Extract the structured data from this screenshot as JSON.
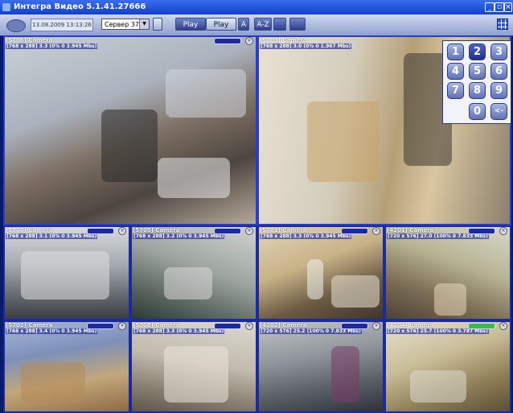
{
  "window": {
    "title": "Интегра Видео 5.1.41.27666"
  },
  "toolbar": {
    "datetime": "13.08.2009  13:13:26",
    "server": "Сервер 37",
    "buttons": [
      "Play",
      "Play",
      "A",
      "A-Z",
      "",
      ""
    ]
  },
  "cameras": [
    {
      "label": "[5706] Camera",
      "info": "[768 x 288] 3.3 (0% 0 3.945 Mbs)"
    },
    {
      "label": "[5703] Camera",
      "info": "[768 x 288] 3.0 (0% 0 1.967 Mbs)"
    },
    {
      "label": "[5707] Camera",
      "info": "[768 x 288] 3.1 (0% 0 3.945 Mbs)"
    },
    {
      "label": "[5705] Camera",
      "info": "[768 x 288] 3.2 (0% 0 3.945 Mbs)"
    },
    {
      "label": "[5701] Camera",
      "info": "[768 x 288] 3.3 (0% 0 3.945 Mbs)"
    },
    {
      "label": "[4201] Camera",
      "info": "[720 x 576] 27.0 (100% 0 7.833 Mbs)"
    },
    {
      "label": "[5702] Camera",
      "info": "[768 x 288] 3.4 (0% 0 3.945 Mbs)"
    },
    {
      "label": "[5708] Camera",
      "info": "[768 x 288] 3.3 (0% 0 3.945 Mbs)"
    },
    {
      "label": "[4202] Camera",
      "info": "[720 x 576] 25.2 (100% 0 7.833 Mbs)"
    },
    {
      "label": "[4204] Camera",
      "info": "[720 x 576] 25.7 (100% 0 3.787 Mbs)"
    }
  ],
  "keypad": {
    "keys": [
      "1",
      "2",
      "3",
      "4",
      "5",
      "6",
      "7",
      "8",
      "9",
      "0",
      "<-"
    ],
    "selected": "2"
  }
}
